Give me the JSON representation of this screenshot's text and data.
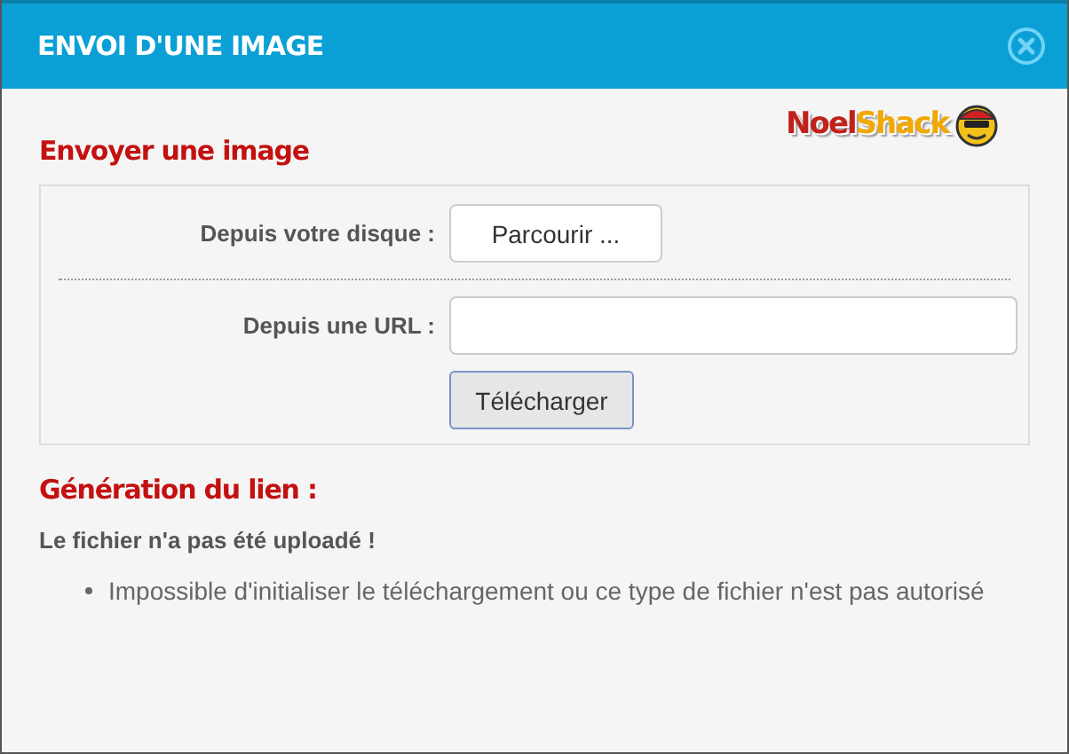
{
  "window": {
    "title": "ENVOI D'UNE IMAGE"
  },
  "logo": {
    "part_1": "Noel",
    "part_2": "Shack"
  },
  "upload": {
    "heading": "Envoyer une image",
    "disk": {
      "label": "Depuis votre disque :",
      "button": "Parcourir ..."
    },
    "url": {
      "label": "Depuis une URL :"
    },
    "submit": "Télécharger"
  },
  "result": {
    "heading": "Génération du lien :",
    "message": "Le fichier n'a pas été uploadé !",
    "errors": [
      "Impossible d'initialiser le téléchargement ou ce type de fichier n'est pas autorisé"
    ]
  }
}
